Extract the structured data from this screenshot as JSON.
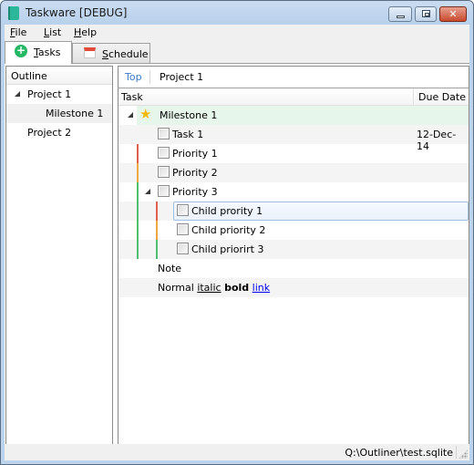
{
  "window": {
    "title": "Taskware [DEBUG]",
    "minimize_glyph": "",
    "maximize_glyph": "",
    "close_glyph": "✕"
  },
  "menu": {
    "items": [
      {
        "label": "File",
        "mnemonic": "F",
        "rest": "ile"
      },
      {
        "label": "List",
        "mnemonic": "L",
        "rest": "ist"
      },
      {
        "label": "Help",
        "mnemonic": "H",
        "rest": "elp"
      }
    ]
  },
  "tabs": [
    {
      "label": "Tasks",
      "mnemonic": "T",
      "rest": "asks",
      "icon": "add-circle-icon",
      "active": true
    },
    {
      "label": "Schedule",
      "mnemonic": "S",
      "rest": "chedule",
      "icon": "calendar-icon",
      "active": false
    }
  ],
  "outline": {
    "header": "Outline",
    "items": [
      {
        "label": "Project 1",
        "expanded": true,
        "level": 0
      },
      {
        "label": "Milestone 1",
        "level": 1,
        "selected": true
      },
      {
        "label": "Project 2",
        "level": 0
      }
    ]
  },
  "breadcrumb": {
    "top": "Top",
    "current": "Project 1"
  },
  "grid": {
    "columns": [
      "Task",
      "Due Date"
    ],
    "rows": [
      {
        "type": "milestone",
        "label": "Milestone 1",
        "icon": "star-icon",
        "expanded": true
      },
      {
        "type": "task",
        "label": "Task 1",
        "due": "12-Dec-14",
        "checked": false
      },
      {
        "type": "task",
        "label": "Priority 1",
        "priority": "high",
        "checked": false
      },
      {
        "type": "task",
        "label": "Priority 2",
        "priority": "medium",
        "checked": false
      },
      {
        "type": "task",
        "label": "Priority 3",
        "priority": "low",
        "expanded": true,
        "checked": false
      },
      {
        "type": "task",
        "label": "Child prority 1",
        "priority": "high",
        "parent_priority": "low",
        "checked": false,
        "selected": true
      },
      {
        "type": "task",
        "label": "Child priority 2",
        "priority": "medium",
        "parent_priority": "low",
        "checked": false
      },
      {
        "type": "task",
        "label": "Child priorirt 3",
        "priority": "low",
        "parent_priority": "low",
        "checked": false
      },
      {
        "type": "note",
        "label": "Note"
      },
      {
        "type": "rich",
        "normal": "Normal",
        "italic": "italic",
        "bold": "bold",
        "link": "link"
      }
    ]
  },
  "priority_colors": {
    "high": "#e06050",
    "medium": "#f0a840",
    "low": "#50c070"
  },
  "status": {
    "path": "Q:\\Outliner\\test.sqlite"
  }
}
